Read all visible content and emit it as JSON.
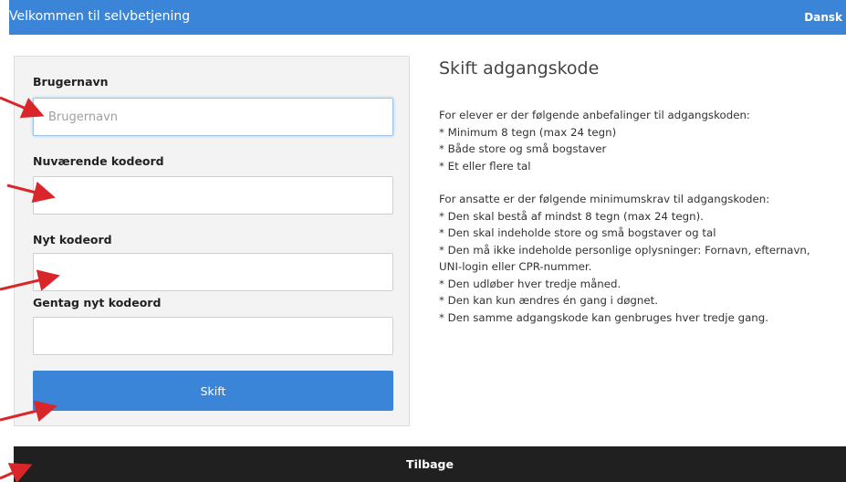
{
  "header": {
    "title": "Velkommen til selvbetjening",
    "language": "Dansk"
  },
  "form": {
    "username": {
      "label": "Brugernavn",
      "placeholder": "Brugernavn",
      "value": ""
    },
    "current_password": {
      "label": "Nuværende kodeord",
      "value": ""
    },
    "new_password": {
      "label": "Nyt kodeord",
      "value": ""
    },
    "repeat_password": {
      "label": "Gentag nyt kodeord",
      "value": ""
    },
    "submit_label": "Skift"
  },
  "info": {
    "heading": "Skift adgangskode",
    "students": [
      "For elever er der følgende anbefalinger til adgangskoden:",
      "* Minimum 8 tegn (max 24 tegn)",
      "* Både store og små bogstaver",
      "* Et eller flere tal"
    ],
    "employees": [
      "For ansatte er der følgende minimumskrav til adgangskoden:",
      "* Den skal bestå af mindst 8 tegn (max 24 tegn).",
      "* Den skal indeholde store og små bogstaver og tal",
      "* Den må ikke indeholde personlige oplysninger: Fornavn, efternavn,",
      "UNI-login eller CPR-nummer.",
      "* Den udløber hver tredje måned.",
      "* Den kan kun ændres én gang i døgnet.",
      "* Den samme adgangskode kan genbruges hver tredje gang."
    ]
  },
  "footer": {
    "back_label": "Tilbage"
  },
  "colors": {
    "primary": "#3a85d8",
    "footer": "#202020",
    "annotation_arrow": "#d9262b"
  }
}
